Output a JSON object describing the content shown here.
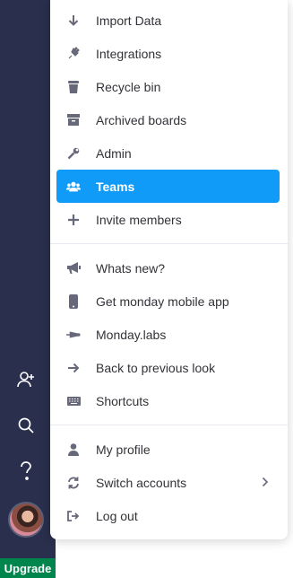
{
  "menu": {
    "items": [
      {
        "label": "Import Data",
        "icon": "arrow-down-icon"
      },
      {
        "label": "Integrations",
        "icon": "plug-icon"
      },
      {
        "label": "Recycle bin",
        "icon": "trash-icon"
      },
      {
        "label": "Archived boards",
        "icon": "archive-icon"
      },
      {
        "label": "Admin",
        "icon": "wrench-icon"
      },
      {
        "label": "Teams",
        "icon": "users-icon",
        "active": true
      },
      {
        "label": "Invite members",
        "icon": "plus-icon"
      },
      {
        "label": "Whats new?",
        "icon": "megaphone-icon"
      },
      {
        "label": "Get monday mobile app",
        "icon": "mobile-icon"
      },
      {
        "label": "Monday.labs",
        "icon": "labs-icon"
      },
      {
        "label": "Back to previous look",
        "icon": "arrow-right-icon"
      },
      {
        "label": "Shortcuts",
        "icon": "keyboard-icon"
      },
      {
        "label": "My profile",
        "icon": "user-icon"
      },
      {
        "label": "Switch accounts",
        "icon": "sync-icon"
      },
      {
        "label": "Log out",
        "icon": "logout-icon"
      }
    ]
  },
  "sidebar": {
    "icons": [
      "add-user-icon",
      "search-icon",
      "help-icon"
    ],
    "upgrade_label": "Upgrade"
  },
  "colors": {
    "sidebar_bg": "#292f4c",
    "active_bg": "#0f9bf7",
    "upgrade_bg": "#00854d",
    "text": "#323338"
  }
}
